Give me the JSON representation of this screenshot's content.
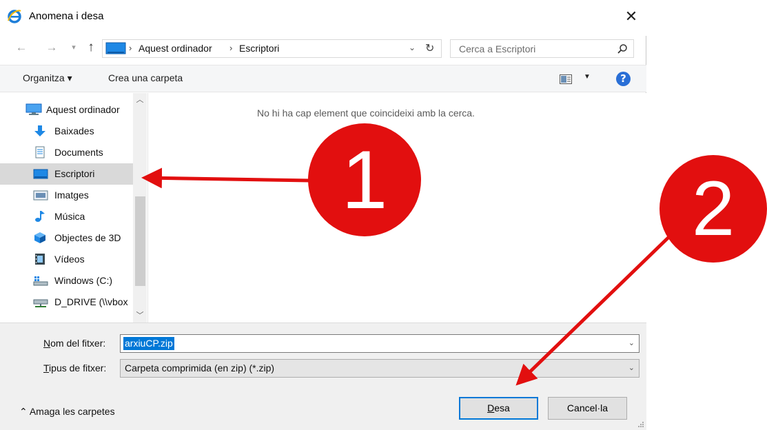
{
  "window": {
    "title": "Anomena i desa",
    "close_glyph": "✕"
  },
  "address": {
    "crumbs": [
      "Aquest ordinador",
      "Escriptori"
    ],
    "search_placeholder": "Cerca a Escriptori"
  },
  "toolbar": {
    "organize_label": "Organitza ▾",
    "new_folder_label": "Crea una carpeta",
    "help_glyph": "?"
  },
  "nav": {
    "items": [
      {
        "label": "Aquest ordinador",
        "icon": "computer-icon"
      },
      {
        "label": "Baixades",
        "icon": "download-icon"
      },
      {
        "label": "Documents",
        "icon": "document-icon"
      },
      {
        "label": "Escriptori",
        "icon": "desktop-icon",
        "selected": true
      },
      {
        "label": "Imatges",
        "icon": "pictures-icon"
      },
      {
        "label": "Música",
        "icon": "music-icon"
      },
      {
        "label": "Objectes de 3D",
        "icon": "3d-objects-icon"
      },
      {
        "label": "Vídeos",
        "icon": "videos-icon"
      },
      {
        "label": "Windows (C:)",
        "icon": "drive-icon"
      },
      {
        "label": "D_DRIVE (\\\\vbox",
        "icon": "network-drive-icon"
      }
    ]
  },
  "content": {
    "empty_message": "No hi ha cap element que coincideixi amb la cerca."
  },
  "form": {
    "filename_label_key": "N",
    "filename_label_rest": "om del fitxer:",
    "filename_value": "arxiuCP.zip",
    "filetype_label_key": "T",
    "filetype_label_rest": "ipus de fitxer:",
    "filetype_value": "Carpeta comprimida (en zip) (*.zip)"
  },
  "footer": {
    "hide_folders_label": "⌃  Amaga les carpetes",
    "save_key": "D",
    "save_rest": "esa",
    "cancel_label": "Cancel·la"
  },
  "annotations": {
    "marker_1": "1",
    "marker_2": "2",
    "color": "#e20f0f"
  }
}
